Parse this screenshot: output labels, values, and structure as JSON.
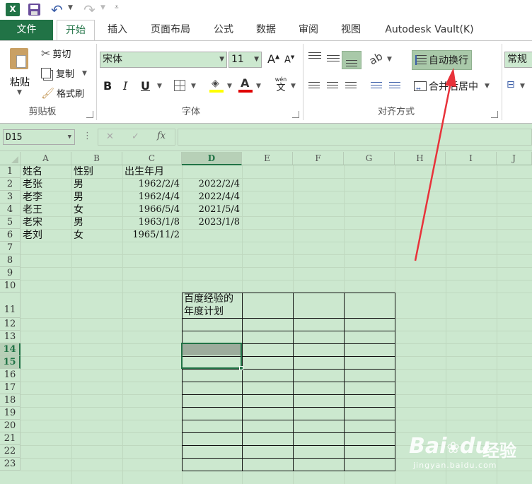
{
  "tabs": [
    "文件",
    "开始",
    "插入",
    "页面布局",
    "公式",
    "数据",
    "审阅",
    "视图",
    "Autodesk Vault(K)"
  ],
  "clipboard": {
    "paste": "粘贴",
    "cut": "剪切",
    "copy": "复制",
    "format_painter": "格式刷",
    "group": "剪贴板"
  },
  "font": {
    "name": "宋体",
    "size": "11",
    "grow": "A",
    "shrink": "A",
    "bold": "B",
    "italic": "I",
    "underline": "U",
    "phonetic_top": "wén",
    "phonetic_bottom": "文",
    "group": "字体"
  },
  "alignment": {
    "wrap": "自动换行",
    "merge": "合并后居中",
    "group": "对齐方式"
  },
  "number": {
    "format": "常规"
  },
  "formula_bar": {
    "name_box": "D15",
    "fx": "fx",
    "cancel": "✕",
    "enter": "✓",
    "more": "⋮"
  },
  "columns": [
    "A",
    "B",
    "C",
    "D",
    "E",
    "F",
    "G",
    "H",
    "I",
    "J"
  ],
  "rows": [
    "1",
    "2",
    "3",
    "4",
    "5",
    "6",
    "7",
    "8",
    "9",
    "10",
    "11",
    "12",
    "13",
    "14",
    "15",
    "16",
    "17",
    "18",
    "19",
    "20",
    "21",
    "22",
    "23"
  ],
  "table": {
    "headers": [
      "姓名",
      "性别",
      "出生年月"
    ],
    "rows": [
      {
        "name": "老张",
        "gender": "男",
        "birth": "1962/2/4",
        "date": "2022/2/4"
      },
      {
        "name": "老李",
        "gender": "男",
        "birth": "1962/4/4",
        "date": "2022/4/4"
      },
      {
        "name": "老王",
        "gender": "女",
        "birth": "1966/5/4",
        "date": "2021/5/4"
      },
      {
        "name": "老宋",
        "gender": "男",
        "birth": "1963/1/8",
        "date": "2023/1/8"
      },
      {
        "name": "老刘",
        "gender": "女",
        "birth": "1965/11/2",
        "date": ""
      }
    ]
  },
  "plan_box": {
    "line1": "百度经验的",
    "line2": "年度计划"
  },
  "watermark": {
    "brand": "Bai",
    "paw": "du",
    "cn": "经验",
    "url": "jingyan.baidu.com"
  },
  "colors": {
    "excel_green": "#217346",
    "sheet_bg": "#cce8cf",
    "arrow": "#e8323a",
    "selection": "#9cac9c"
  }
}
